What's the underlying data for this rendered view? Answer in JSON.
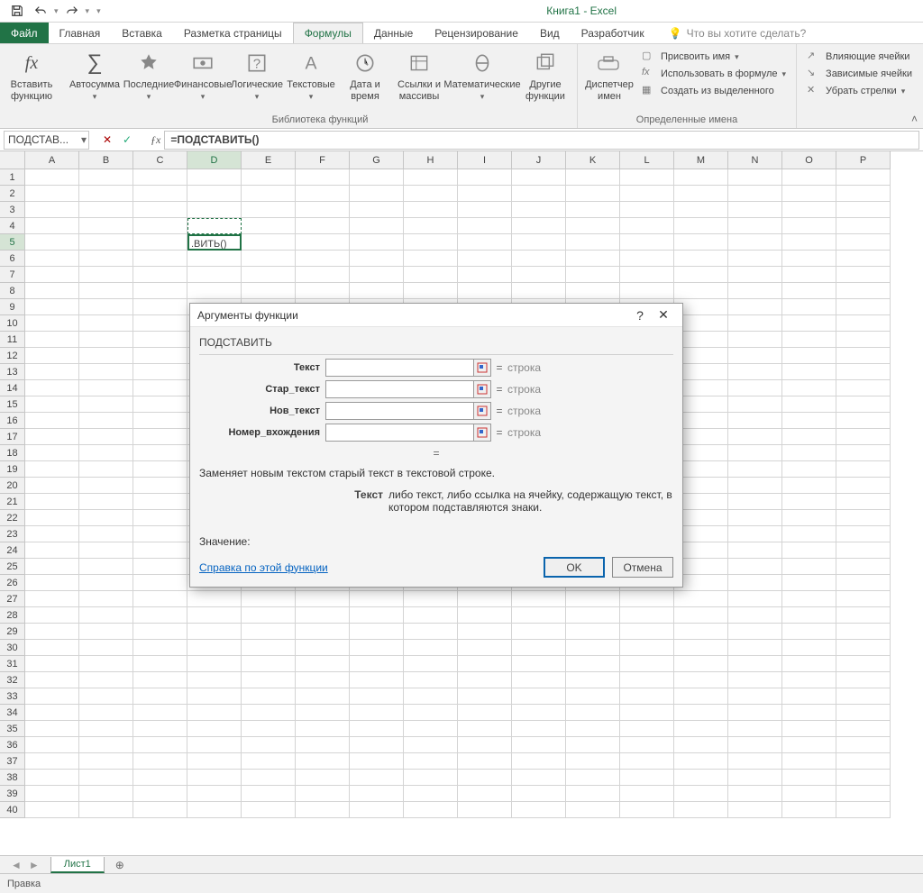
{
  "app": {
    "title": "Книга1 - Excel"
  },
  "qat": {
    "save": "save",
    "undo": "undo",
    "redo": "redo"
  },
  "tabs": {
    "file": "Файл",
    "home": "Главная",
    "insert": "Вставка",
    "layout": "Разметка страницы",
    "formulas": "Формулы",
    "data": "Данные",
    "review": "Рецензирование",
    "view": "Вид",
    "developer": "Разработчик",
    "tellme": "Что вы хотите сделать?"
  },
  "ribbon": {
    "insert_fn": "Вставить\nфункцию",
    "autosum": "Автосумма",
    "recent": "Последние",
    "financial": "Финансовые",
    "logical": "Логические",
    "text_fn": "Текстовые",
    "date": "Дата и\nвремя",
    "lookup": "Ссылки и\nмассивы",
    "math": "Математические",
    "more": "Другие\nфункции",
    "lib_label": "Библиотека функций",
    "name_mgr": "Диспетчер\nимен",
    "def_name": "Присвоить имя",
    "use_formula": "Использовать в формуле",
    "from_sel": "Создать из выделенного",
    "names_label": "Определенные имена",
    "trace_prec": "Влияющие ячейки",
    "trace_dep": "Зависимые ячейки",
    "remove_arrows": "Убрать стрелки"
  },
  "fbar": {
    "name": "ПОДСТАВ...",
    "formula": "=ПОДСТАВИТЬ()"
  },
  "cols": [
    "A",
    "B",
    "C",
    "D",
    "E",
    "F",
    "G",
    "H",
    "I",
    "J",
    "K",
    "L",
    "M",
    "N",
    "O",
    "P"
  ],
  "cell_d5": ".ВИТЬ()",
  "sheet": {
    "tab": "Лист1"
  },
  "status": {
    "mode": "Правка"
  },
  "dialog": {
    "title": "Аргументы функции",
    "func": "ПОДСТАВИТЬ",
    "args": [
      {
        "label": "Текст",
        "hint": "строка"
      },
      {
        "label": "Стар_текст",
        "hint": "строка"
      },
      {
        "label": "Нов_текст",
        "hint": "строка"
      },
      {
        "label": "Номер_вхождения",
        "hint": "строка"
      }
    ],
    "eq": "=",
    "desc": "Заменяет новым текстом старый текст в текстовой строке.",
    "arg_label": "Текст",
    "arg_desc": "либо текст, либо ссылка на ячейку, содержащую текст, в котором подставляются знаки.",
    "value_label": "Значение:",
    "help_link": "Справка по этой функции",
    "ok": "OK",
    "cancel": "Отмена"
  }
}
